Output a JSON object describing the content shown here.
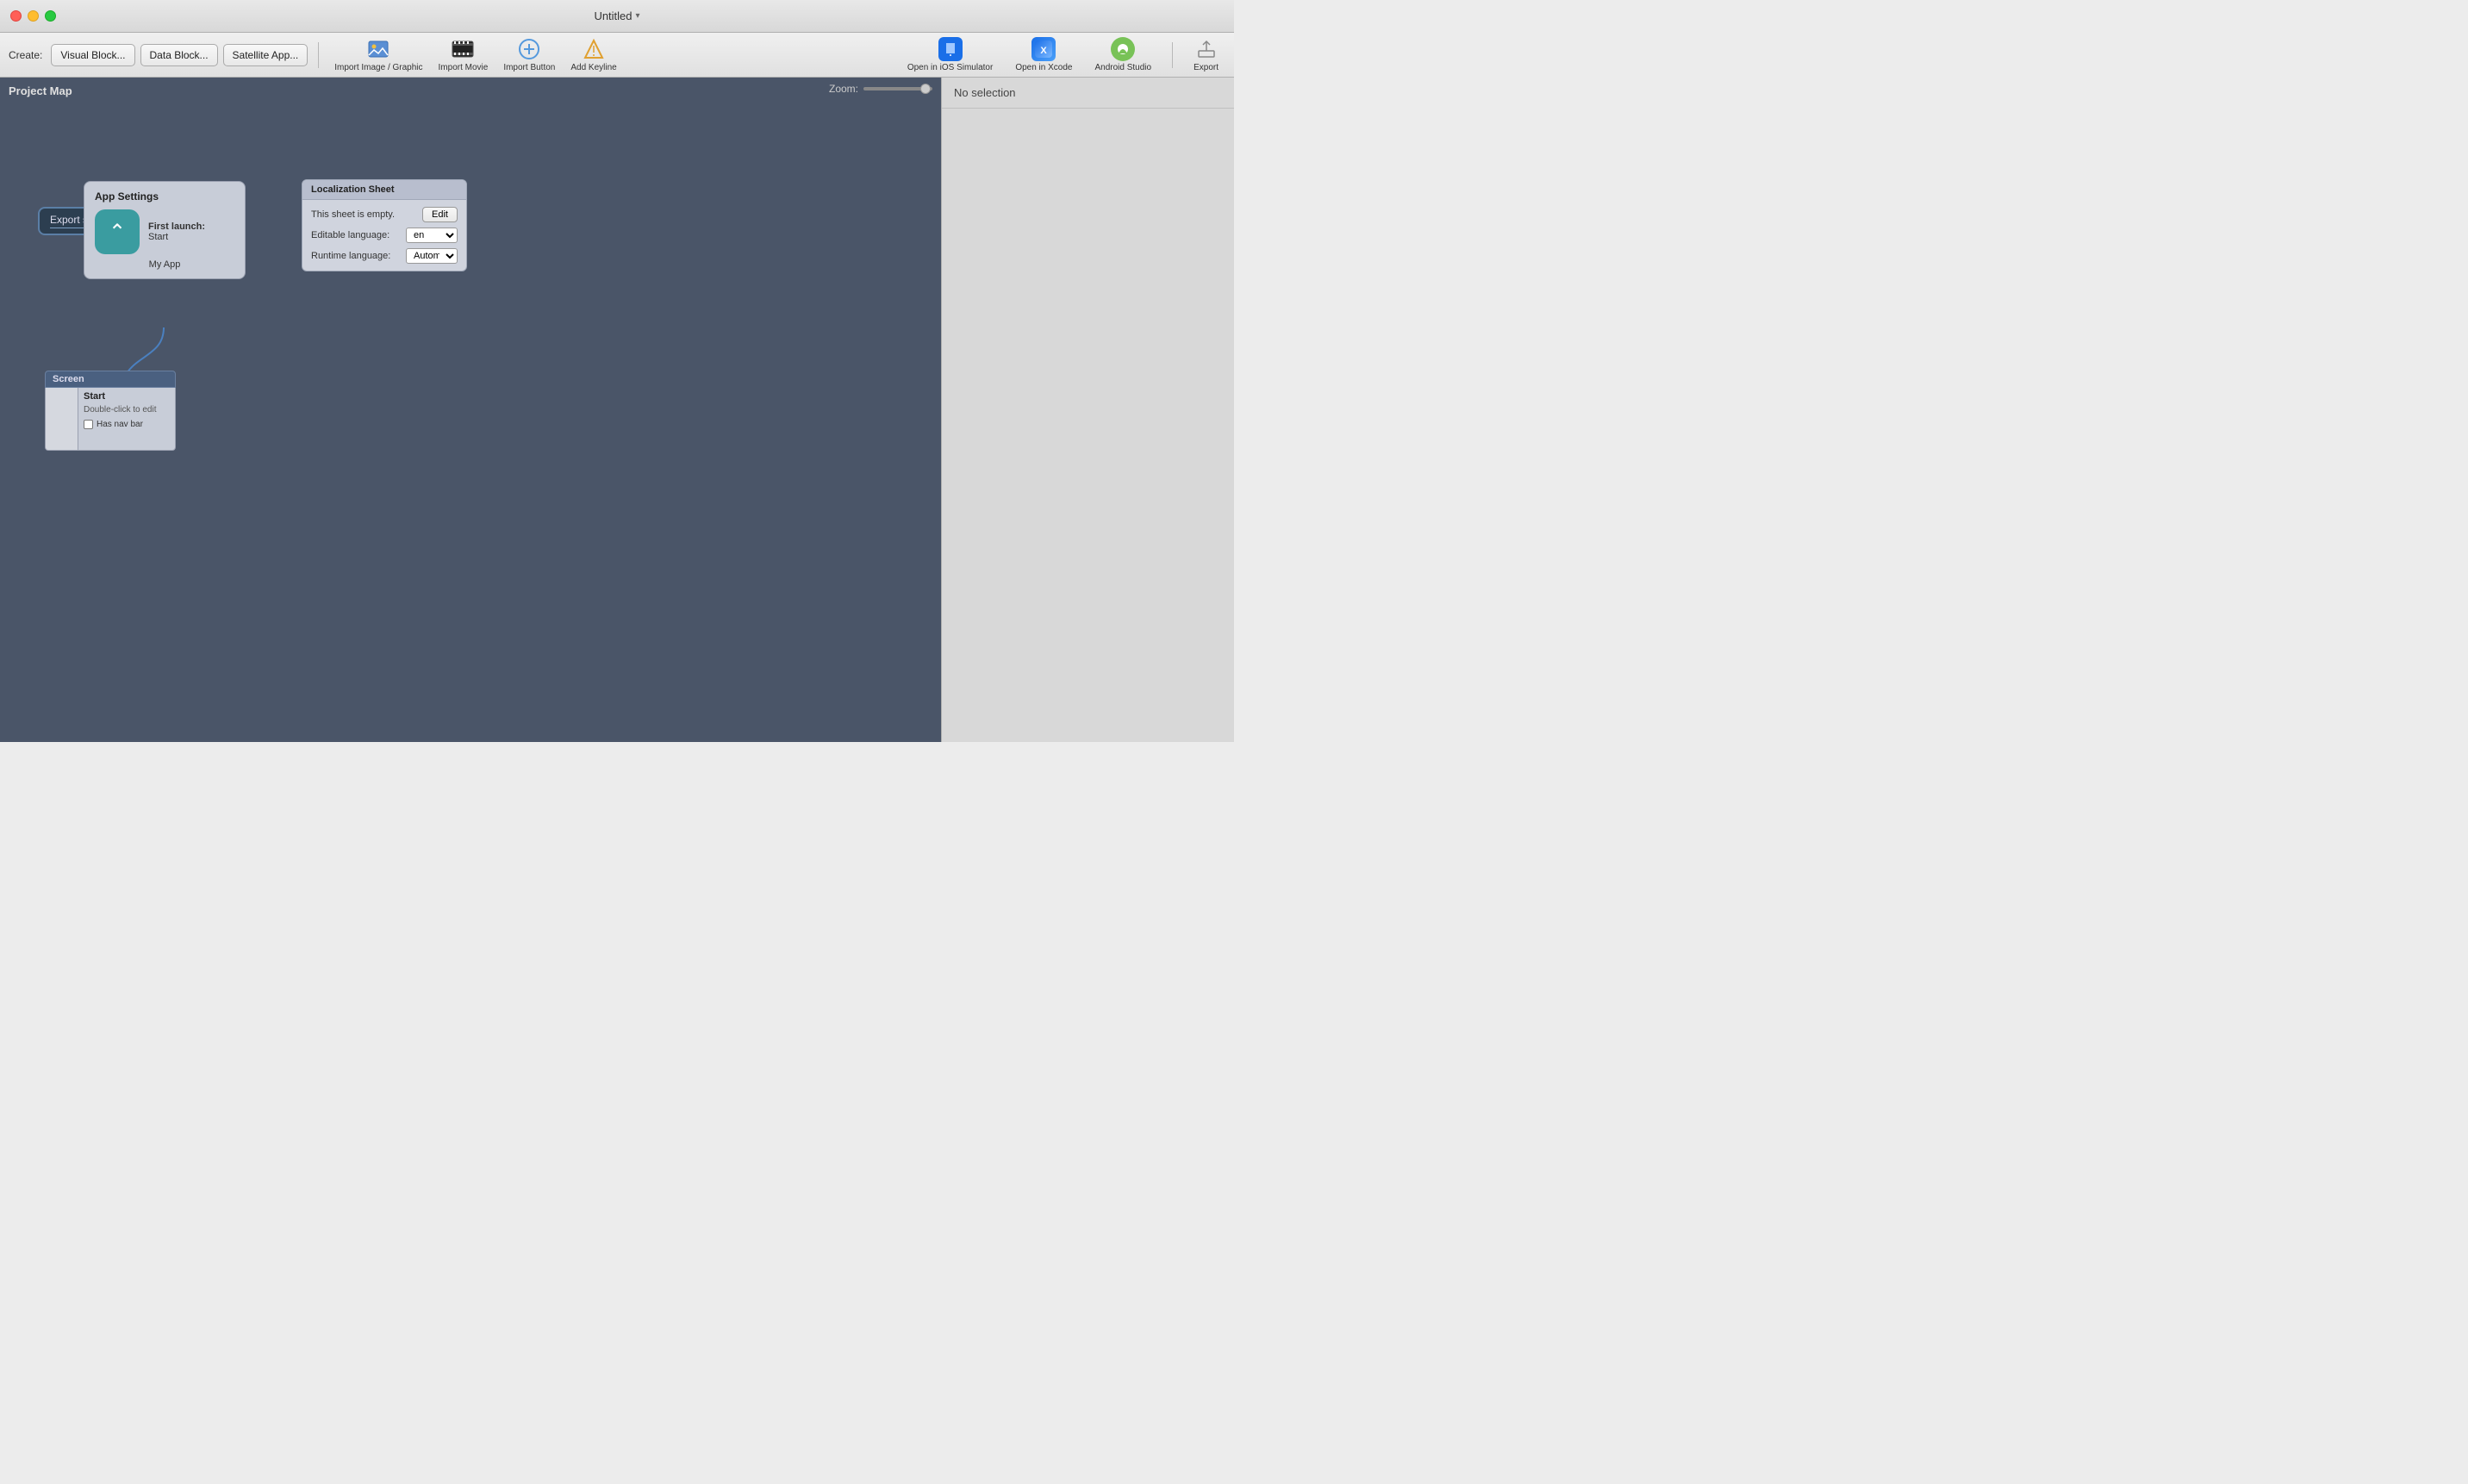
{
  "titlebar": {
    "title": "Untitled",
    "dropdown_arrow": "▾"
  },
  "toolbar": {
    "create_label": "Create:",
    "visual_block_btn": "Visual Block...",
    "data_block_btn": "Data Block...",
    "satellite_app_btn": "Satellite App...",
    "import_image_label": "Import Image / Graphic",
    "import_movie_label": "Import Movie",
    "import_button_label": "Import Button",
    "add_keyline_label": "Add Keyline",
    "open_ios_sim_label": "Open in iOS Simulator",
    "open_xcode_label": "Open in Xcode",
    "android_studio_label": "Android Studio",
    "export_label": "Export"
  },
  "canvas": {
    "project_map_label": "Project Map",
    "zoom_label": "Zoom:"
  },
  "export_screens_node": {
    "label": "Export screens"
  },
  "app_settings_node": {
    "title": "App Settings",
    "first_launch_label": "First launch:",
    "start_label": "Start",
    "app_name": "My App"
  },
  "screen_node": {
    "header": "Screen",
    "name": "Start",
    "hint": "Double-click to edit",
    "has_nav_bar": "Has nav bar"
  },
  "localization_sheet": {
    "title": "Localization Sheet",
    "empty_msg": "This sheet is empty.",
    "edit_btn": "Edit",
    "editable_lang_label": "Editable language:",
    "editable_lang_value": "en",
    "runtime_lang_label": "Runtime language:",
    "runtime_lang_value": "Automatic"
  },
  "right_panel": {
    "no_selection": "No selection"
  }
}
